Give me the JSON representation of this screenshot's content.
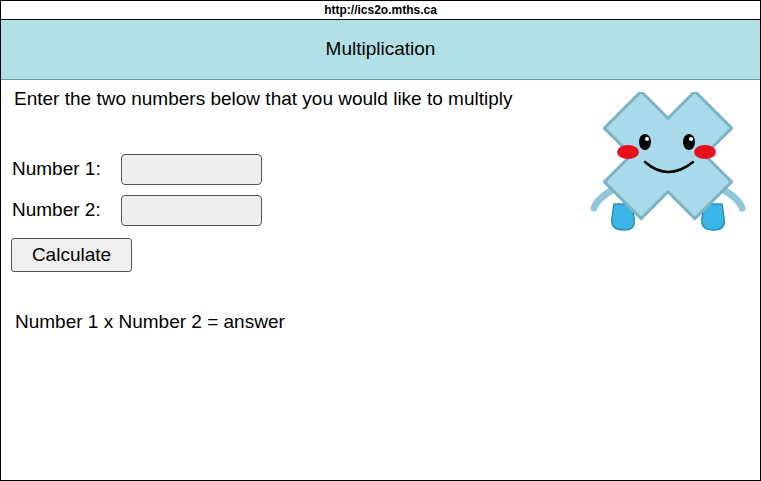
{
  "browser": {
    "url": "http://ics2o.mths.ca"
  },
  "header": {
    "title": "Multiplication"
  },
  "instructions": "Enter the two numbers below that you would like to multiply",
  "fields": [
    {
      "label": "Number 1:",
      "value": ""
    },
    {
      "label": "Number 2:",
      "value": ""
    }
  ],
  "button": "Calculate",
  "result": "Number 1 x Number 2 = answer"
}
